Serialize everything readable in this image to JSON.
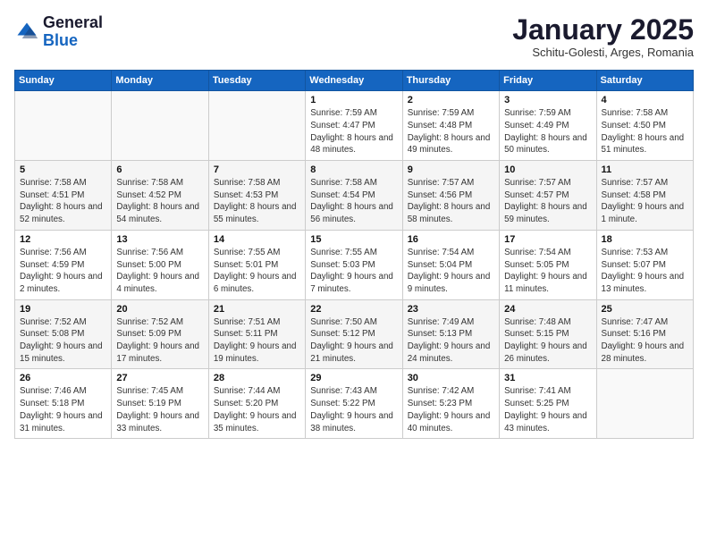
{
  "header": {
    "logo_general": "General",
    "logo_blue": "Blue",
    "month_title": "January 2025",
    "subtitle": "Schitu-Golesti, Arges, Romania"
  },
  "days_of_week": [
    "Sunday",
    "Monday",
    "Tuesday",
    "Wednesday",
    "Thursday",
    "Friday",
    "Saturday"
  ],
  "weeks": [
    [
      {
        "day": "",
        "info": ""
      },
      {
        "day": "",
        "info": ""
      },
      {
        "day": "",
        "info": ""
      },
      {
        "day": "1",
        "info": "Sunrise: 7:59 AM\nSunset: 4:47 PM\nDaylight: 8 hours and 48 minutes."
      },
      {
        "day": "2",
        "info": "Sunrise: 7:59 AM\nSunset: 4:48 PM\nDaylight: 8 hours and 49 minutes."
      },
      {
        "day": "3",
        "info": "Sunrise: 7:59 AM\nSunset: 4:49 PM\nDaylight: 8 hours and 50 minutes."
      },
      {
        "day": "4",
        "info": "Sunrise: 7:58 AM\nSunset: 4:50 PM\nDaylight: 8 hours and 51 minutes."
      }
    ],
    [
      {
        "day": "5",
        "info": "Sunrise: 7:58 AM\nSunset: 4:51 PM\nDaylight: 8 hours and 52 minutes."
      },
      {
        "day": "6",
        "info": "Sunrise: 7:58 AM\nSunset: 4:52 PM\nDaylight: 8 hours and 54 minutes."
      },
      {
        "day": "7",
        "info": "Sunrise: 7:58 AM\nSunset: 4:53 PM\nDaylight: 8 hours and 55 minutes."
      },
      {
        "day": "8",
        "info": "Sunrise: 7:58 AM\nSunset: 4:54 PM\nDaylight: 8 hours and 56 minutes."
      },
      {
        "day": "9",
        "info": "Sunrise: 7:57 AM\nSunset: 4:56 PM\nDaylight: 8 hours and 58 minutes."
      },
      {
        "day": "10",
        "info": "Sunrise: 7:57 AM\nSunset: 4:57 PM\nDaylight: 8 hours and 59 minutes."
      },
      {
        "day": "11",
        "info": "Sunrise: 7:57 AM\nSunset: 4:58 PM\nDaylight: 9 hours and 1 minute."
      }
    ],
    [
      {
        "day": "12",
        "info": "Sunrise: 7:56 AM\nSunset: 4:59 PM\nDaylight: 9 hours and 2 minutes."
      },
      {
        "day": "13",
        "info": "Sunrise: 7:56 AM\nSunset: 5:00 PM\nDaylight: 9 hours and 4 minutes."
      },
      {
        "day": "14",
        "info": "Sunrise: 7:55 AM\nSunset: 5:01 PM\nDaylight: 9 hours and 6 minutes."
      },
      {
        "day": "15",
        "info": "Sunrise: 7:55 AM\nSunset: 5:03 PM\nDaylight: 9 hours and 7 minutes."
      },
      {
        "day": "16",
        "info": "Sunrise: 7:54 AM\nSunset: 5:04 PM\nDaylight: 9 hours and 9 minutes."
      },
      {
        "day": "17",
        "info": "Sunrise: 7:54 AM\nSunset: 5:05 PM\nDaylight: 9 hours and 11 minutes."
      },
      {
        "day": "18",
        "info": "Sunrise: 7:53 AM\nSunset: 5:07 PM\nDaylight: 9 hours and 13 minutes."
      }
    ],
    [
      {
        "day": "19",
        "info": "Sunrise: 7:52 AM\nSunset: 5:08 PM\nDaylight: 9 hours and 15 minutes."
      },
      {
        "day": "20",
        "info": "Sunrise: 7:52 AM\nSunset: 5:09 PM\nDaylight: 9 hours and 17 minutes."
      },
      {
        "day": "21",
        "info": "Sunrise: 7:51 AM\nSunset: 5:11 PM\nDaylight: 9 hours and 19 minutes."
      },
      {
        "day": "22",
        "info": "Sunrise: 7:50 AM\nSunset: 5:12 PM\nDaylight: 9 hours and 21 minutes."
      },
      {
        "day": "23",
        "info": "Sunrise: 7:49 AM\nSunset: 5:13 PM\nDaylight: 9 hours and 24 minutes."
      },
      {
        "day": "24",
        "info": "Sunrise: 7:48 AM\nSunset: 5:15 PM\nDaylight: 9 hours and 26 minutes."
      },
      {
        "day": "25",
        "info": "Sunrise: 7:47 AM\nSunset: 5:16 PM\nDaylight: 9 hours and 28 minutes."
      }
    ],
    [
      {
        "day": "26",
        "info": "Sunrise: 7:46 AM\nSunset: 5:18 PM\nDaylight: 9 hours and 31 minutes."
      },
      {
        "day": "27",
        "info": "Sunrise: 7:45 AM\nSunset: 5:19 PM\nDaylight: 9 hours and 33 minutes."
      },
      {
        "day": "28",
        "info": "Sunrise: 7:44 AM\nSunset: 5:20 PM\nDaylight: 9 hours and 35 minutes."
      },
      {
        "day": "29",
        "info": "Sunrise: 7:43 AM\nSunset: 5:22 PM\nDaylight: 9 hours and 38 minutes."
      },
      {
        "day": "30",
        "info": "Sunrise: 7:42 AM\nSunset: 5:23 PM\nDaylight: 9 hours and 40 minutes."
      },
      {
        "day": "31",
        "info": "Sunrise: 7:41 AM\nSunset: 5:25 PM\nDaylight: 9 hours and 43 minutes."
      },
      {
        "day": "",
        "info": ""
      }
    ]
  ]
}
